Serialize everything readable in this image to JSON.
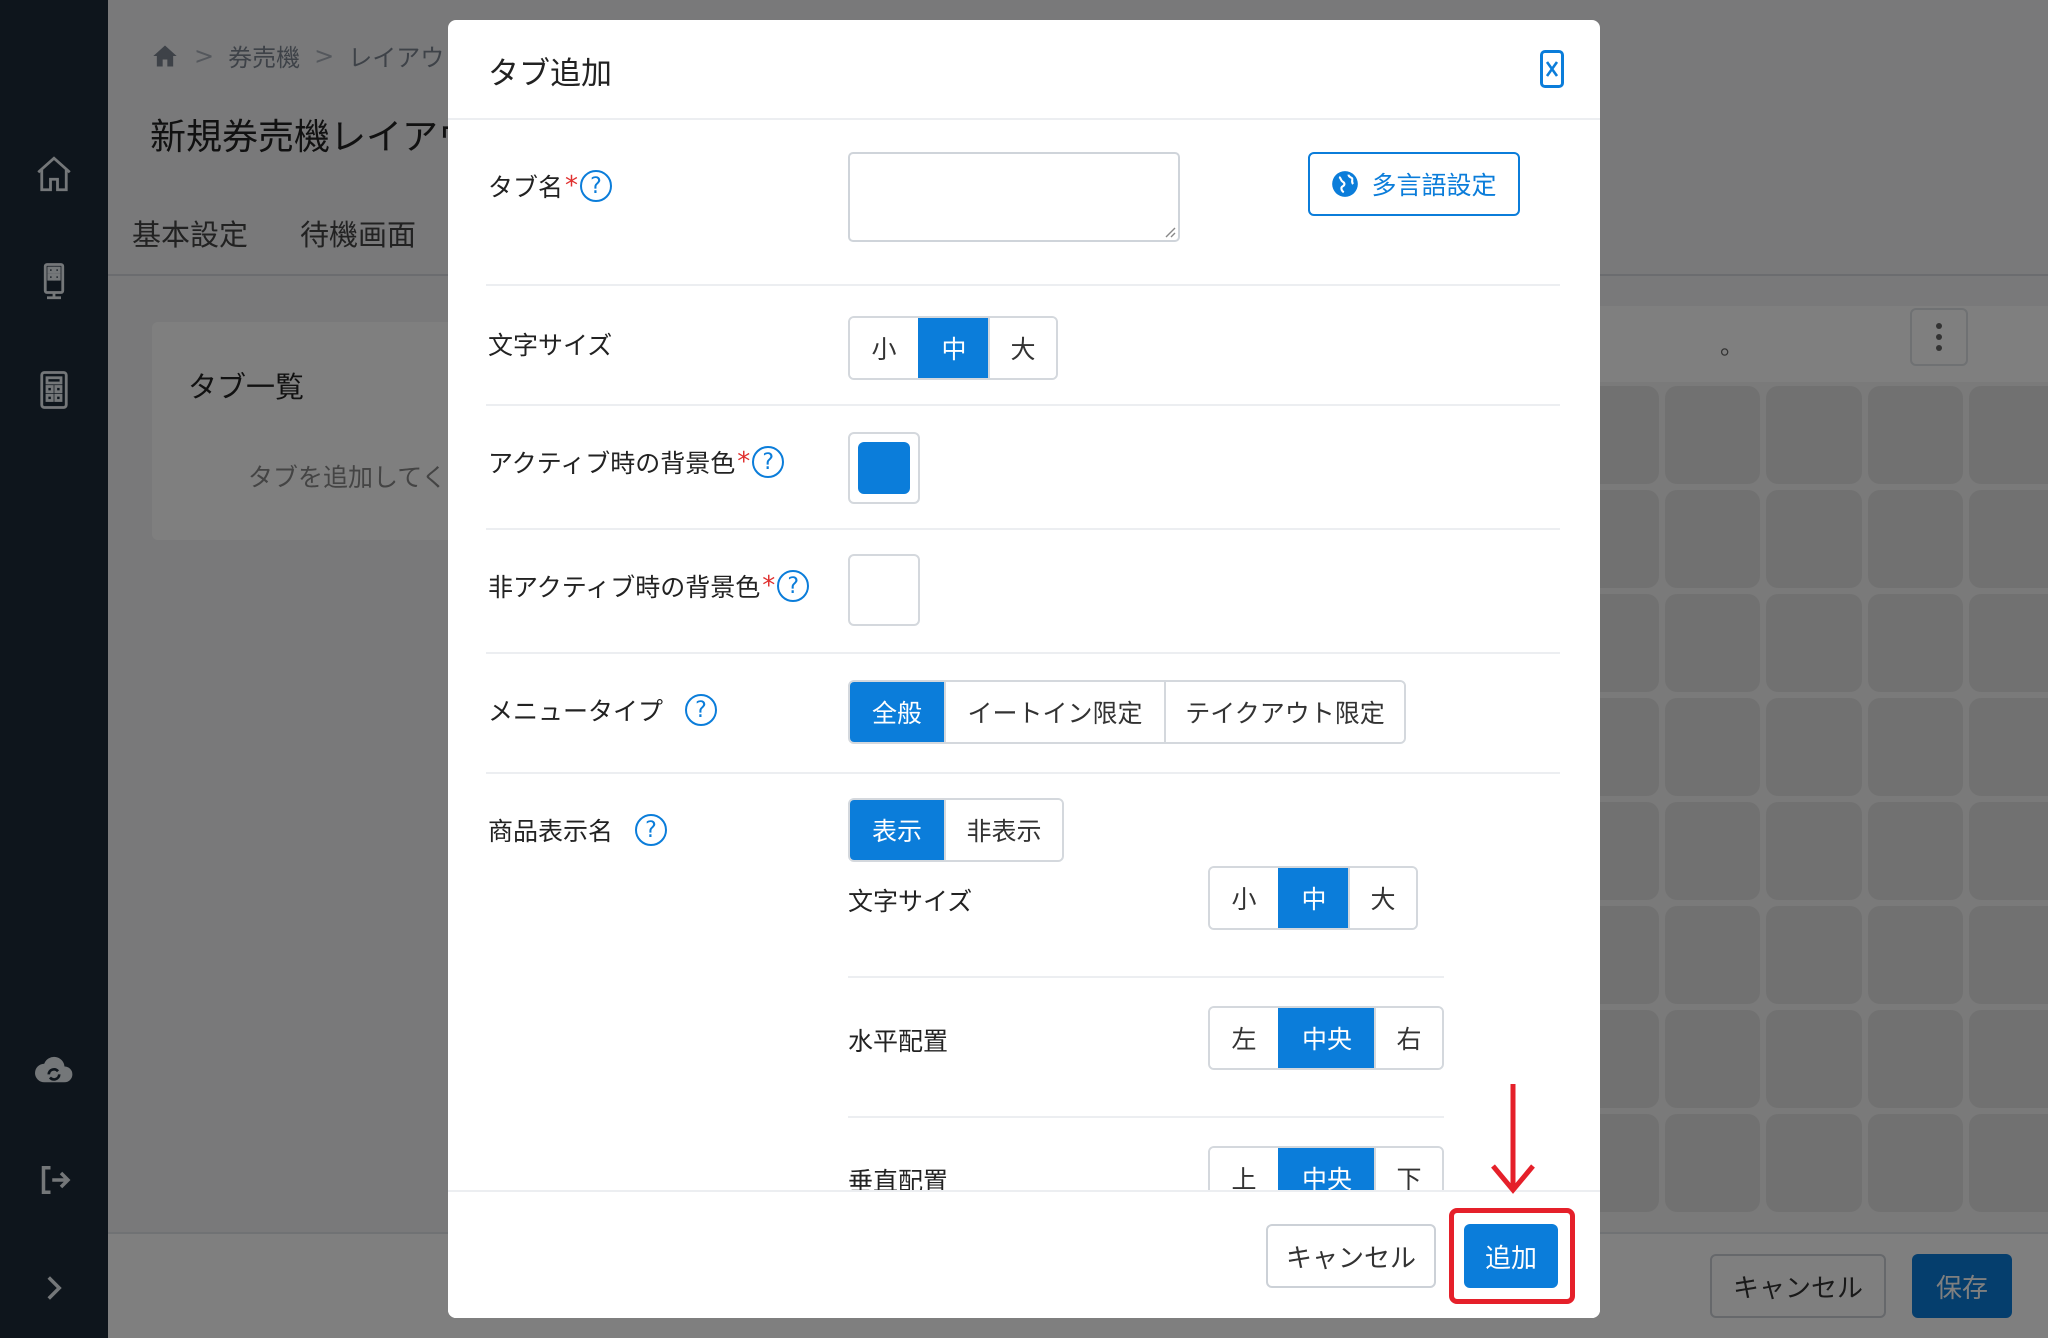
{
  "app": {
    "breadcrumb": [
      "券売機",
      "レイアウト"
    ],
    "page_title": "新規券売機レイアウト",
    "tabs": [
      "基本設定",
      "待機画面"
    ],
    "tab_list": {
      "title": "タブ一覧",
      "placeholder": "タブを追加してください"
    },
    "right_note": "。",
    "footer": {
      "cancel": "キャンセル",
      "save": "保存"
    }
  },
  "modal": {
    "title": "タブ追加",
    "fields": {
      "tab_name": {
        "label": "タブ名",
        "required": "*",
        "help": "?",
        "value": "",
        "lang_button": "多言語設定"
      },
      "font_size": {
        "label": "文字サイズ",
        "options": [
          "小",
          "中",
          "大"
        ],
        "selected": "中"
      },
      "active_bg": {
        "label": "アクティブ時の背景色",
        "required": "*",
        "help": "?",
        "color": "#0b7dda"
      },
      "inactive_bg": {
        "label": "非アクティブ時の背景色",
        "required": "*",
        "help": "?",
        "color": "#ffffff"
      },
      "menu_type": {
        "label": "メニュータイプ",
        "help": "?",
        "options": [
          "全般",
          "イートイン限定",
          "テイクアウト限定"
        ],
        "selected": "全般"
      },
      "product_name": {
        "label": "商品表示名",
        "help": "?",
        "options": [
          "表示",
          "非表示"
        ],
        "selected": "表示",
        "sub": {
          "font_size": {
            "label": "文字サイズ",
            "options": [
              "小",
              "中",
              "大"
            ],
            "selected": "中"
          },
          "horizontal": {
            "label": "水平配置",
            "options": [
              "左",
              "中央",
              "右"
            ],
            "selected": "中央"
          },
          "vertical": {
            "label": "垂直配置",
            "options": [
              "上",
              "中央",
              "下"
            ],
            "selected": "中央"
          }
        }
      }
    },
    "footer": {
      "cancel": "キャンセル",
      "add": "追加"
    }
  },
  "colors": {
    "accent": "#0b7dda",
    "sidebar": "#1c2a38",
    "highlight": "#e5202a"
  }
}
